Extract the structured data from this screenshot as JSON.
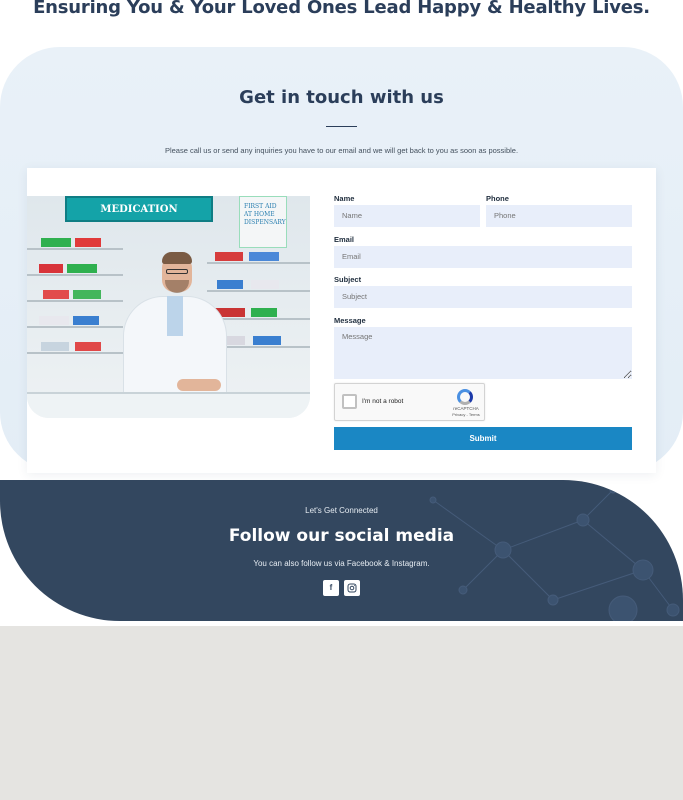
{
  "hero": {
    "tagline": "Ensuring You & Your Loved Ones Lead Happy & Healthy Lives."
  },
  "contact": {
    "title": "Get in touch with us",
    "subtitle": "Please call us or send any inquiries you have to our email and we will get back to you as soon as possible.",
    "image": {
      "sign_text": "MEDICATION",
      "sign2_text": "FIRST AID AT HOME DISPENSARY"
    },
    "form": {
      "name_label": "Name",
      "name_placeholder": "Name",
      "phone_label": "Phone",
      "phone_placeholder": "Phone",
      "email_label": "Email",
      "email_placeholder": "Email",
      "subject_label": "Subject",
      "subject_placeholder": "Subject",
      "message_label": "Message",
      "message_placeholder": "Message",
      "captcha_label": "I'm not a robot",
      "captcha_brand": "reCAPTCHA",
      "captcha_terms": "Privacy - Terms",
      "submit_label": "Submit"
    }
  },
  "social": {
    "kicker": "Let's Get Connected",
    "title": "Follow our social media",
    "subtitle": "You can also follow us via Facebook & Instagram.",
    "icons": [
      "facebook-icon",
      "instagram-icon"
    ]
  },
  "colors": {
    "navy": "#33475f",
    "accent": "#1a87c4",
    "field_bg": "#e8eefa",
    "section_bg": "#e9f1f8",
    "footer_bg": "#e5e4e1"
  }
}
